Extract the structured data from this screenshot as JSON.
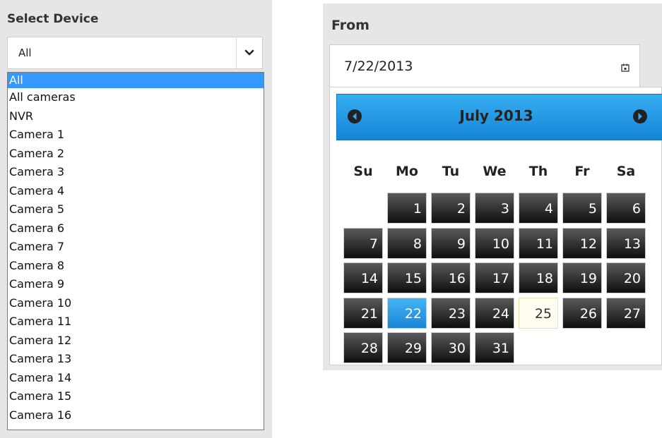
{
  "device": {
    "title": "Select Device",
    "selected_value": "All",
    "options": [
      "All",
      "All cameras",
      "NVR",
      "Camera 1",
      "Camera 2",
      "Camera 3",
      "Camera 4",
      "Camera 5",
      "Camera 6",
      "Camera 7",
      "Camera 8",
      "Camera 9",
      "Camera 10",
      "Camera 11",
      "Camera 12",
      "Camera 13",
      "Camera 14",
      "Camera 15",
      "Camera 16"
    ],
    "highlighted_option": "All"
  },
  "date_picker": {
    "label": "From",
    "value": "7/22/2013",
    "month_title": "July 2013",
    "weekdays": [
      "Su",
      "Mo",
      "Tu",
      "We",
      "Th",
      "Fr",
      "Sa"
    ],
    "days": [
      "1",
      "2",
      "3",
      "4",
      "5",
      "6",
      "7",
      "8",
      "9",
      "10",
      "11",
      "12",
      "13",
      "14",
      "15",
      "16",
      "17",
      "18",
      "19",
      "20",
      "21",
      "22",
      "23",
      "24",
      "25",
      "26",
      "27",
      "28",
      "29",
      "30",
      "31"
    ],
    "selected_day": "22",
    "today_day": "25",
    "first_weekday_index": 1
  },
  "icons": {
    "select_chevron": "chevron-down-icon",
    "calendar": "calendar-icon",
    "prev": "prev-month-icon",
    "next": "next-month-icon"
  },
  "colors": {
    "panel_bg": "#e6e6e6",
    "header_blue": "#2a9be6",
    "selection_blue": "#3399ff",
    "day_dark": "#1a1a1a"
  }
}
